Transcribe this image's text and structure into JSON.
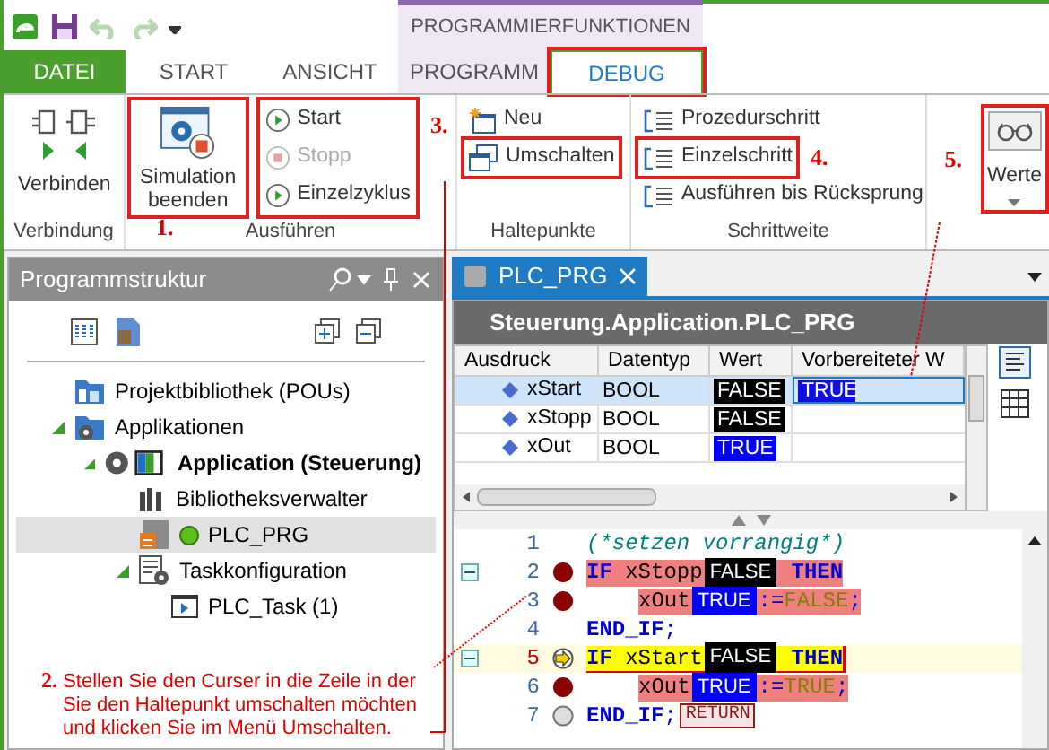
{
  "context_group": {
    "title": "PROGRAMMIERFUNKTIONEN"
  },
  "tabs": [
    {
      "label": "DATEI",
      "kind": "file",
      "selected": false,
      "annotated": false
    },
    {
      "label": "START",
      "kind": "normal",
      "selected": false,
      "annotated": false
    },
    {
      "label": "ANSICHT",
      "kind": "normal",
      "selected": false,
      "annotated": false
    },
    {
      "label": "PROGRAMM",
      "kind": "context",
      "selected": false,
      "annotated": false
    },
    {
      "label": "DEBUG",
      "kind": "context",
      "selected": true,
      "annotated": true
    }
  ],
  "ribbon_groups": [
    {
      "label": "Verbindung",
      "columns": [
        {
          "kind": "large",
          "annotated": false,
          "buttons": [
            {
              "label": "Verbinden",
              "disabled": false
            }
          ]
        }
      ]
    },
    {
      "label": "Ausführen",
      "columns": [
        {
          "kind": "large",
          "annotated": true,
          "note": "1.",
          "buttons": [
            {
              "label": "Simulation beenden",
              "disabled": false
            }
          ]
        },
        {
          "kind": "stack",
          "annotated": true,
          "note": "3.",
          "buttons": [
            {
              "label": "Start",
              "disabled": false,
              "annotated": false
            },
            {
              "label": "Stopp",
              "disabled": true,
              "annotated": false
            },
            {
              "label": "Einzelzyklus",
              "disabled": false,
              "annotated": false
            }
          ]
        }
      ]
    },
    {
      "label": "Haltepunkte",
      "columns": [
        {
          "kind": "stack",
          "annotated": false,
          "buttons": [
            {
              "label": "Neu",
              "disabled": false,
              "annotated": false
            },
            {
              "label": "Umschalten",
              "disabled": false,
              "annotated": true
            }
          ]
        }
      ]
    },
    {
      "label": "Schrittweite",
      "columns": [
        {
          "kind": "stack",
          "annotated": false,
          "buttons": [
            {
              "label": "Prozedurschritt",
              "disabled": false,
              "annotated": false
            },
            {
              "label": "Einzelschritt",
              "disabled": false,
              "annotated": true,
              "note": "4."
            },
            {
              "label": "Ausführen bis Rücksprung",
              "disabled": false,
              "annotated": false
            }
          ]
        }
      ]
    },
    {
      "columns": [
        {
          "kind": "dropdown",
          "annotated": true,
          "note": "5.",
          "buttons": [
            {
              "label": "Werte"
            }
          ]
        }
      ]
    }
  ],
  "structure_panel": {
    "title": "Programmstruktur",
    "tree": [
      {
        "label": "Projektbibliothek (POUs)",
        "kind": "library",
        "selected": false,
        "bold": false
      },
      {
        "label": "Applikationen",
        "kind": "apps",
        "expanded": true,
        "selected": false,
        "bold": false,
        "children": [
          {
            "label": "Application (Steuerung)",
            "kind": "application",
            "expanded": true,
            "selected": false,
            "bold": true,
            "children": [
              {
                "label": "Bibliotheksverwalter",
                "kind": "books",
                "selected": false,
                "bold": false
              },
              {
                "label": "PLC_PRG",
                "kind": "program",
                "selected": true,
                "bold": false,
                "online": true
              },
              {
                "label": "Taskkonfiguration",
                "kind": "tasks",
                "expanded": true,
                "selected": false,
                "bold": false,
                "children": [
                  {
                    "label": "PLC_Task (1)",
                    "kind": "task",
                    "selected": false,
                    "bold": false
                  }
                ]
              }
            ]
          }
        ]
      }
    ],
    "callout": {
      "number": "2.",
      "text": "Stellen Sie den Curser in die Zeile in der Sie den Haltepunkt umschalten möchten und klicken Sie im Menü Umschalten."
    }
  },
  "editor": {
    "tab": {
      "label": "PLC_PRG",
      "selected": true
    },
    "watch": {
      "title": "Steuerung.Application.PLC_PRG",
      "columns": [
        "Ausdruck",
        "Datentyp",
        "Wert",
        "Vorbereiteter W"
      ],
      "rows": [
        {
          "expression": "xStart",
          "type": "BOOL",
          "value": "FALSE",
          "color": "#000000",
          "prepared": "TRUE",
          "selected": true
        },
        {
          "expression": "xStopp",
          "type": "BOOL",
          "value": "FALSE",
          "color": "#000000",
          "selected": false
        },
        {
          "expression": "xOut",
          "type": "BOOL",
          "value": "TRUE",
          "color": "#0000ff",
          "selected": false
        }
      ]
    },
    "code": [
      {
        "number": "1",
        "kind": "plain",
        "fold": false,
        "indented": false,
        "tokens": [
          {
            "kind": "comment",
            "text": "(*setzen vorrangig*)"
          }
        ]
      },
      {
        "number": "2",
        "kind": "breakpoint",
        "fold": true,
        "indented": false,
        "tokens": [
          {
            "kind": "keyword",
            "text": "IF"
          },
          {
            "kind": "ident",
            "text": " xStopp"
          },
          {
            "kind": "monitor",
            "text": "FALSE",
            "color": "#000000"
          },
          {
            "kind": "keyword",
            "text": " THEN"
          }
        ]
      },
      {
        "number": "3",
        "kind": "breakpoint",
        "fold": false,
        "indented": true,
        "tokens": [
          {
            "kind": "ident",
            "text": "xOut"
          },
          {
            "kind": "monitor",
            "text": "TRUE",
            "color": "#0000ff"
          },
          {
            "kind": "op",
            "text": ":="
          },
          {
            "kind": "literal",
            "text": "FALSE"
          },
          {
            "kind": "op",
            "text": ";"
          }
        ]
      },
      {
        "number": "4",
        "kind": "plain",
        "fold": false,
        "indented": false,
        "tokens": [
          {
            "kind": "keyword",
            "text": "END_IF"
          },
          {
            "kind": "op",
            "text": ";"
          }
        ]
      },
      {
        "number": "5",
        "kind": "current",
        "fold": true,
        "indented": false,
        "tokens": [
          {
            "kind": "keyword",
            "text": "IF"
          },
          {
            "kind": "ident",
            "text": " xStart"
          },
          {
            "kind": "monitor",
            "text": "FALSE",
            "color": "#000000"
          },
          {
            "kind": "keyword",
            "text": " THEN"
          }
        ]
      },
      {
        "number": "6",
        "kind": "breakpoint",
        "fold": false,
        "indented": true,
        "tokens": [
          {
            "kind": "ident",
            "text": "xOut"
          },
          {
            "kind": "monitor",
            "text": "TRUE",
            "color": "#0000ff"
          },
          {
            "kind": "op",
            "text": ":="
          },
          {
            "kind": "literal",
            "text": "TRUE"
          },
          {
            "kind": "op",
            "text": ";"
          }
        ]
      },
      {
        "number": "7",
        "kind": "disabled",
        "fold": false,
        "indented": false,
        "tokens": [
          {
            "kind": "keyword",
            "text": "END_IF"
          },
          {
            "kind": "op",
            "text": ";"
          },
          {
            "kind": "return",
            "text": "RETURN"
          }
        ]
      }
    ]
  }
}
